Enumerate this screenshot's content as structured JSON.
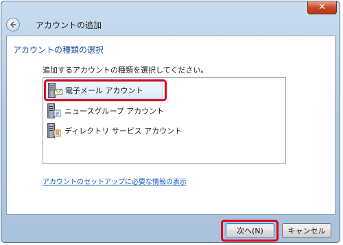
{
  "window": {
    "title": "アカウントの追加",
    "close_glyph": "✕"
  },
  "section_title": "アカウントの種類の選択",
  "instruction": "追加するアカウントの種類を選択してください。",
  "account_types": [
    {
      "label": "電子メール アカウント",
      "icon": "mail-server-icon",
      "selected": true
    },
    {
      "label": "ニュースグループ アカウント",
      "icon": "newsgroup-server-icon",
      "selected": false
    },
    {
      "label": "ディレクトリ サービス アカウント",
      "icon": "directory-server-icon",
      "selected": false
    }
  ],
  "help_link": "アカウントのセットアップに必要な情報の表示",
  "buttons": {
    "next": "次へ(N)",
    "cancel": "キャンセル"
  },
  "colors": {
    "highlight": "#e0001b",
    "section_title": "#1d4e9c",
    "link": "#0a58c2"
  }
}
